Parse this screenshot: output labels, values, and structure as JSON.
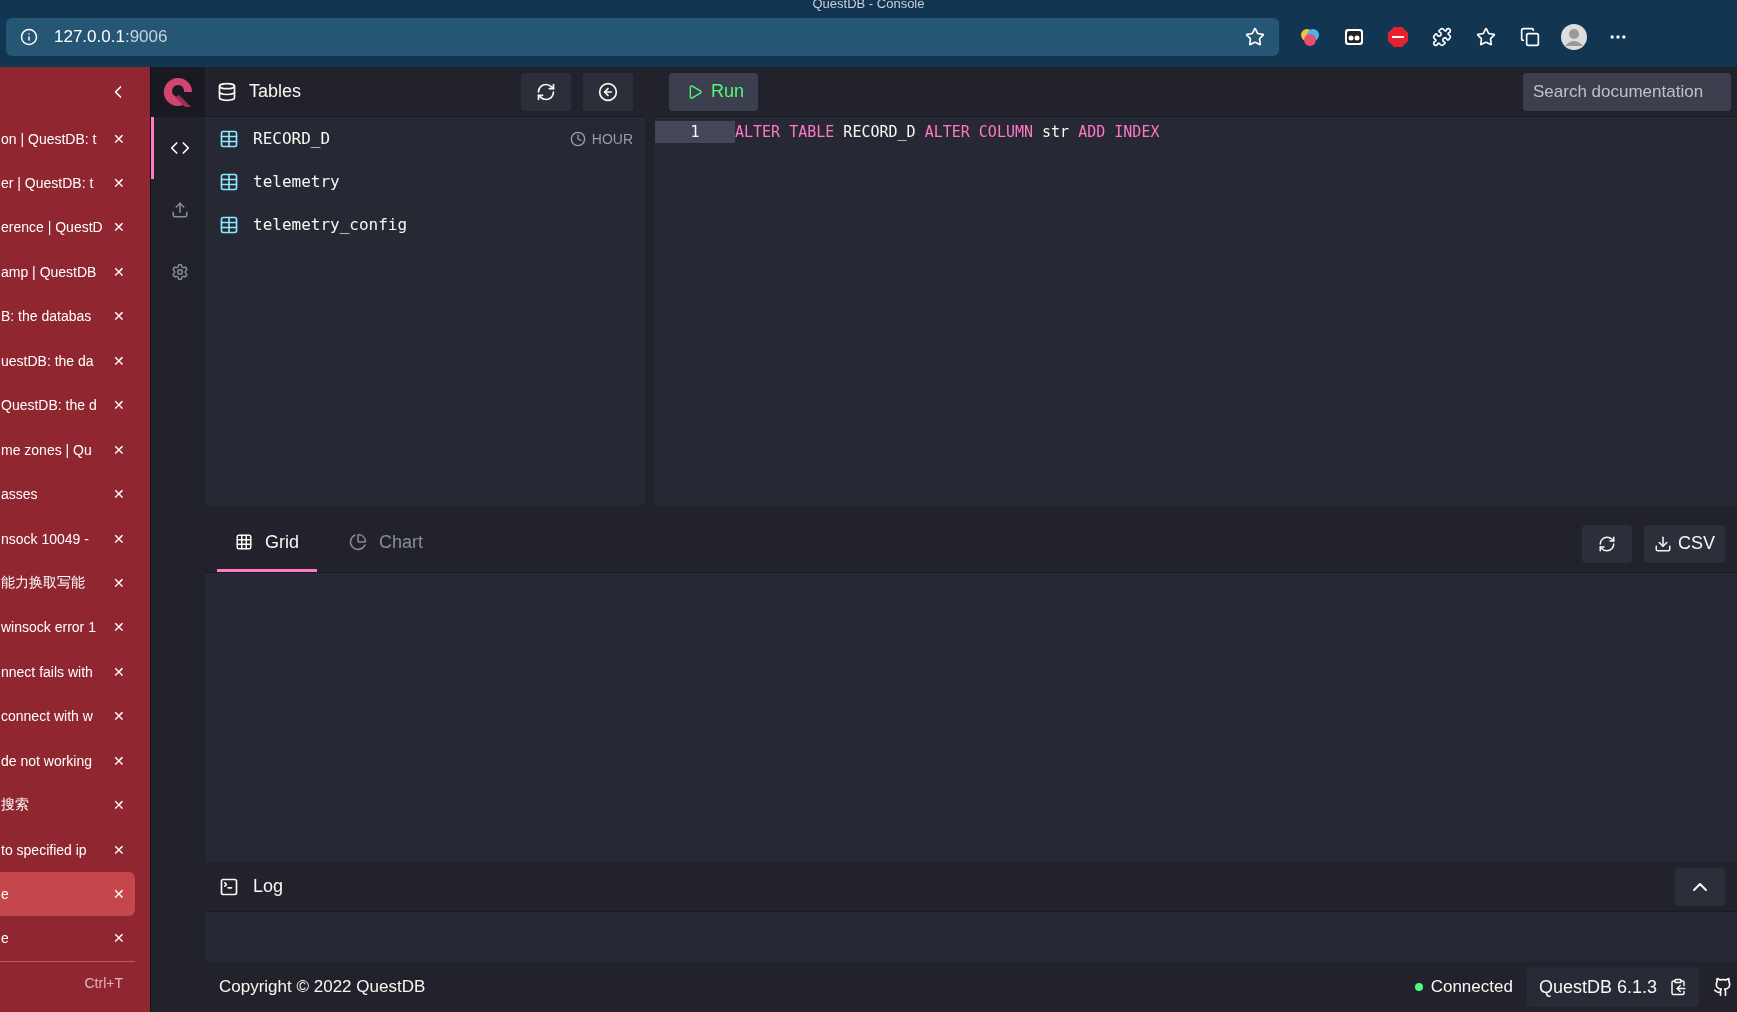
{
  "window": {
    "title": "QuestDB - Console"
  },
  "address_bar": {
    "host": "127.0.0.1",
    "port": ":9006"
  },
  "vertical_tabs": {
    "items": [
      {
        "label": "on | QuestDB: t",
        "selected": false
      },
      {
        "label": "er | QuestDB: t",
        "selected": false
      },
      {
        "label": "erence | QuestD",
        "selected": false
      },
      {
        "label": "amp | QuestDB",
        "selected": false
      },
      {
        "label": "B: the databas",
        "selected": false
      },
      {
        "label": "uestDB: the da",
        "selected": false
      },
      {
        "label": "QuestDB: the d",
        "selected": false
      },
      {
        "label": "me zones | Qu",
        "selected": false
      },
      {
        "label": "asses",
        "selected": false
      },
      {
        "label": "nsock 10049 -",
        "selected": false
      },
      {
        "label": "能力换取写能",
        "selected": false
      },
      {
        "label": "winsock error 1",
        "selected": false
      },
      {
        "label": "nnect fails with",
        "selected": false
      },
      {
        "label": "connect with w",
        "selected": false
      },
      {
        "label": "de not working",
        "selected": false
      },
      {
        "label": "搜索",
        "selected": false
      },
      {
        "label": "to specified ip",
        "selected": false
      },
      {
        "label": "e",
        "selected": true
      },
      {
        "label": "e",
        "selected": false
      }
    ],
    "close_glyph": "✕",
    "shortcut": "Ctrl+T"
  },
  "nav": [
    {
      "kind": "code",
      "selected": true
    },
    {
      "kind": "upload",
      "selected": false
    },
    {
      "kind": "settings",
      "selected": false
    }
  ],
  "tables_panel": {
    "title": "Tables",
    "tables": [
      {
        "name": "RECORD_D",
        "partition": "HOUR"
      },
      {
        "name": "telemetry"
      },
      {
        "name": "telemetry_config"
      }
    ]
  },
  "editor": {
    "run_label": "Run",
    "search_placeholder": "Search documentation",
    "lines": [
      {
        "number": "1",
        "tokens": [
          {
            "text": "ALTER",
            "kind": "keyword"
          },
          {
            "text": "TABLE",
            "kind": "keyword"
          },
          {
            "text": "RECORD_D",
            "kind": "identifier"
          },
          {
            "text": "ALTER",
            "kind": "keyword"
          },
          {
            "text": "COLUMN",
            "kind": "keyword"
          },
          {
            "text": "str",
            "kind": "identifier"
          },
          {
            "text": "ADD",
            "kind": "keyword"
          },
          {
            "text": "INDEX",
            "kind": "keyword"
          }
        ]
      }
    ]
  },
  "results": {
    "tabs": [
      {
        "label": "Grid",
        "kind": "grid",
        "selected": true
      },
      {
        "label": "Chart",
        "kind": "chart",
        "selected": false
      }
    ],
    "csv_label": "CSV"
  },
  "log": {
    "title": "Log"
  },
  "footer": {
    "copyright": "Copyright © 2022 QuestDB",
    "status": "Connected",
    "connected": true,
    "version": "QuestDB 6.1.3"
  }
}
